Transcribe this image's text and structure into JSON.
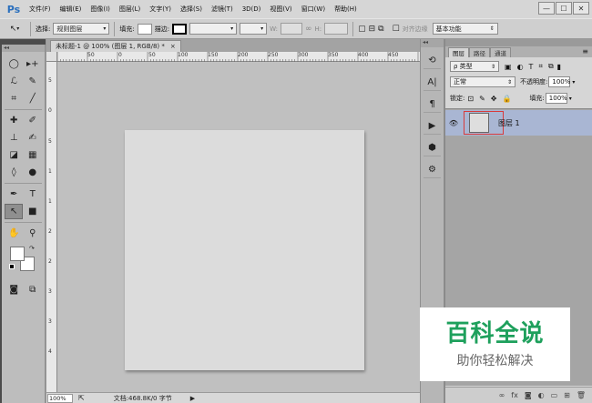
{
  "app": {
    "logo": "Ps"
  },
  "menubar": {
    "items": [
      "文件(F)",
      "编辑(E)",
      "图像(I)",
      "图层(L)",
      "文字(Y)",
      "选择(S)",
      "滤镜(T)",
      "3D(D)",
      "视图(V)",
      "窗口(W)",
      "帮助(H)"
    ],
    "window_controls": [
      "—",
      "☐",
      "✕"
    ]
  },
  "options": {
    "select_label": "选择:",
    "select_value": "规则图层",
    "fill_label": "填充:",
    "stroke_label": "描边:",
    "w_label": "W:",
    "h_label": "H:",
    "align_edges_label": "对齐边缘",
    "workspace": "基本功能"
  },
  "document": {
    "tab_title": "未标题-1 @ 100% (图层 1, RGB/8) *",
    "tab_close": "×",
    "ruler_h_labels": [
      "50",
      "0",
      "50",
      "100",
      "150",
      "200",
      "250",
      "300",
      "350",
      "400",
      "450"
    ],
    "ruler_v_labels": [
      "5",
      "0",
      "5",
      "1",
      "1",
      "2",
      "2",
      "3",
      "3",
      "4"
    ],
    "zoom": "100%",
    "doc_info": "文档:468.8K/0 字节"
  },
  "panels": {
    "tabs": [
      "图层",
      "路径",
      "通道"
    ],
    "active_tab": "图层",
    "filter_type": "ρ 类型",
    "blend_mode": "正常",
    "opacity_label": "不透明度:",
    "opacity_value": "100%",
    "lock_label": "锁定:",
    "fill_label": "填充:",
    "fill_value": "100%",
    "layer": {
      "name": "图层 1",
      "visible": true
    }
  },
  "watermark": {
    "title": "百科全说",
    "subtitle": "助你轻松解决"
  },
  "colors": {
    "accent": "#2a6fbd",
    "selection": "#a9b6d3",
    "highlight_border": "#d93a3a",
    "watermark_green": "#1ea05c"
  }
}
